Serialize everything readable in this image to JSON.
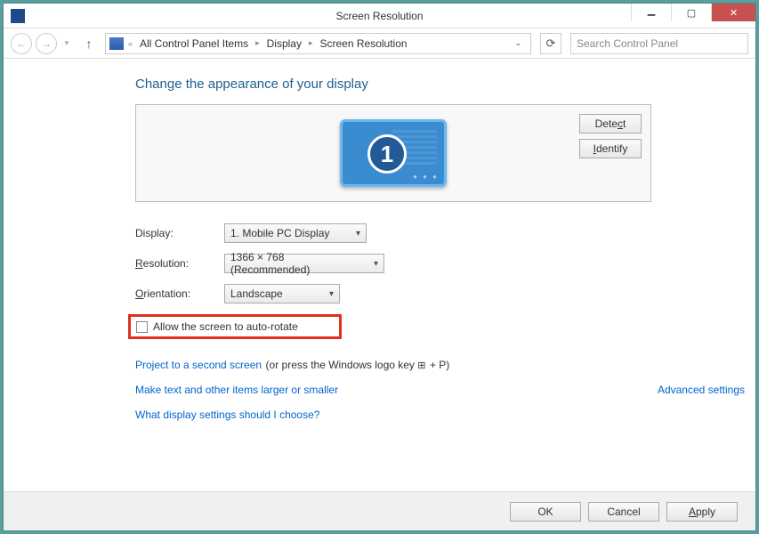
{
  "window": {
    "title": "Screen Resolution"
  },
  "breadcrumb": {
    "items": [
      "All Control Panel Items",
      "Display",
      "Screen Resolution"
    ]
  },
  "search": {
    "placeholder": "Search Control Panel"
  },
  "page": {
    "heading": "Change the appearance of your display",
    "detect": "Detect",
    "identify": "Identify",
    "monitor_number": "1"
  },
  "form": {
    "display_label": "Display:",
    "display_value": "1. Mobile PC Display",
    "resolution_label": "Resolution:",
    "resolution_value": "1366 × 768 (Recommended)",
    "orientation_label": "Orientation:",
    "orientation_value": "Landscape"
  },
  "autorotate": {
    "label": "Allow the screen to auto-rotate",
    "checked": false
  },
  "links": {
    "advanced": "Advanced settings",
    "project_link": "Project to a second screen",
    "project_suffix": " (or press the Windows logo key ",
    "project_suffix2": " + P)",
    "text_size": "Make text and other items larger or smaller",
    "help": "What display settings should I choose?"
  },
  "footer": {
    "ok": "OK",
    "cancel": "Cancel",
    "apply": "Apply"
  }
}
